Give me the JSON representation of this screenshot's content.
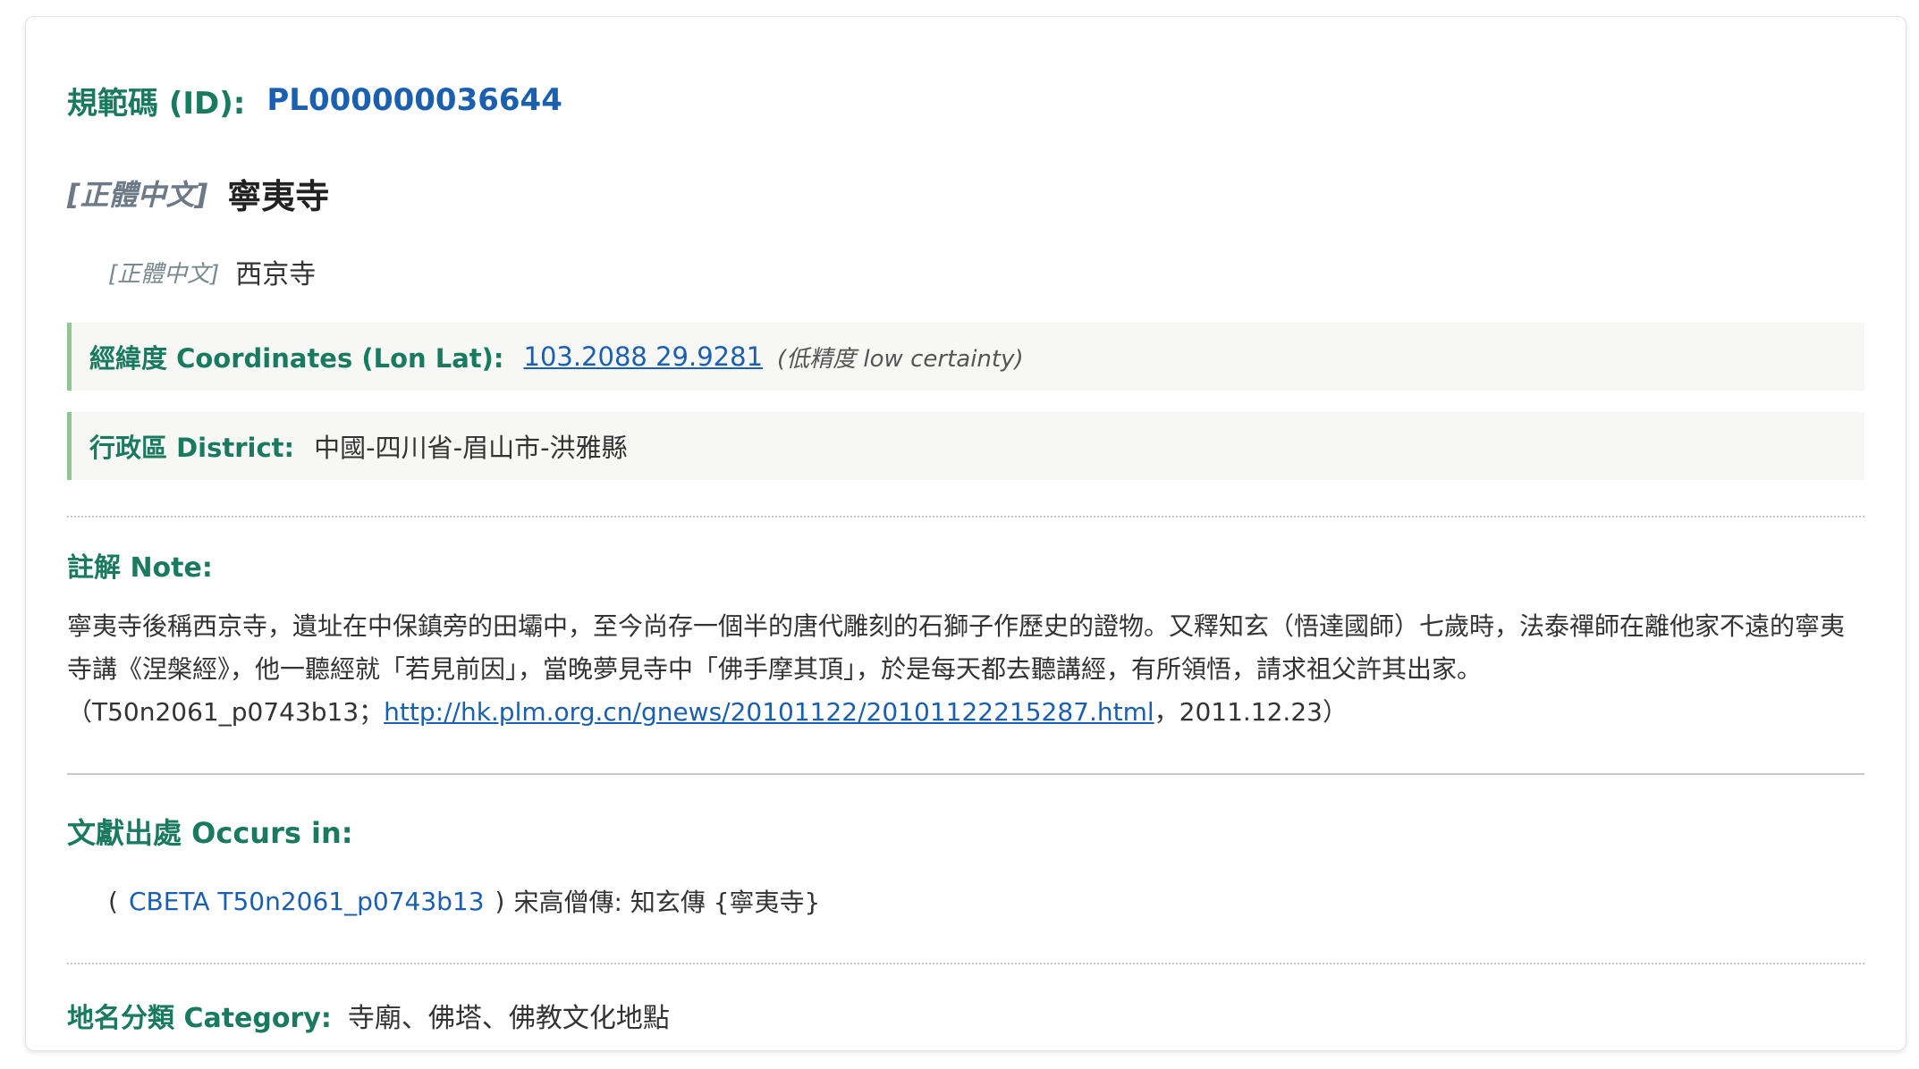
{
  "id_row": {
    "label": "規範碼 (ID):",
    "value": "PL000000036644"
  },
  "primary_name": {
    "lang_tag": "[正體中文]",
    "name": "寧夷寺"
  },
  "alt_name": {
    "lang_tag": "[正體中文]",
    "name": "西京寺"
  },
  "coordinates": {
    "label": "經緯度 Coordinates (Lon Lat):",
    "value": "103.2088 29.9281",
    "certainty": "(低精度 low certainty)"
  },
  "district": {
    "label": "行政區 District:",
    "value": "中國-四川省-眉山市-洪雅縣"
  },
  "note": {
    "label": "註解 Note:",
    "text": "寧夷寺後稱西京寺，遺址在中保鎮旁的田壩中，至今尚存一個半的唐代雕刻的石獅子作歷史的證物。又釋知玄（悟達國師）七歲時，法泰禪師在離他家不遠的寧夷寺講《涅槃經》，他一聽經就「若見前因」，當晚夢見寺中「佛手摩其頂」，於是每天都去聽講經，有所領悟，請求祖父許其出家。",
    "ref_prefix": "（T50n2061_p0743b13；",
    "ref_url": "http://hk.plm.org.cn/gnews/20101122/20101122215287.html",
    "ref_suffix": "，2011.12.23）"
  },
  "occurs": {
    "label": "文獻出處 Occurs in:",
    "open_paren": "(",
    "link": "CBETA T50n2061_p0743b13",
    "close_paren": ")",
    "source": "宋高僧傳: 知玄傳 {寧夷寺}"
  },
  "category": {
    "label": "地名分類 Category:",
    "value": "寺廟、佛塔、佛教文化地點"
  }
}
